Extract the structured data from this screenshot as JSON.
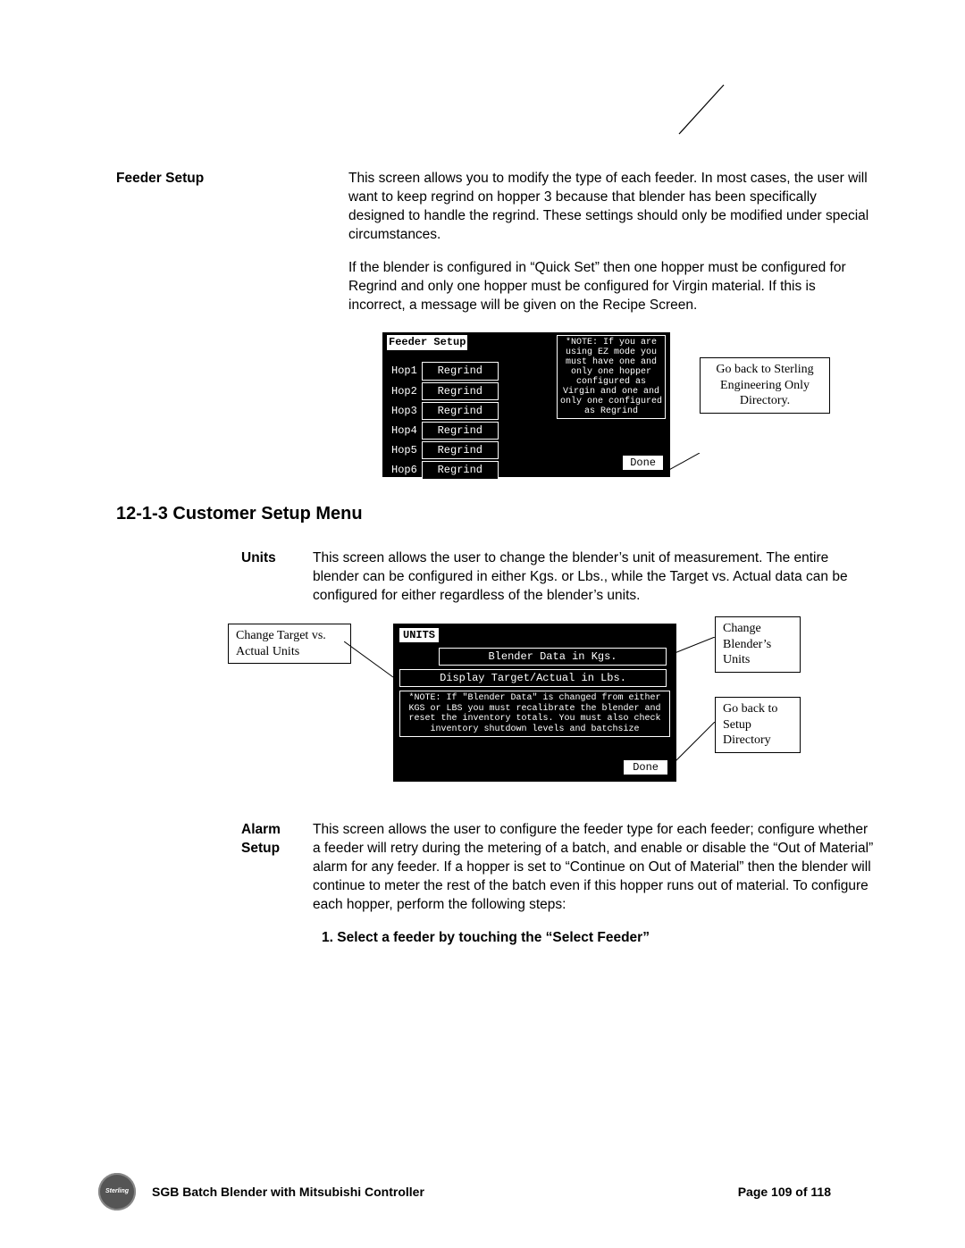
{
  "feeder_setup": {
    "heading": "Feeder Setup",
    "para1": "This screen allows you to modify the type of each feeder.  In most cases, the user will want to keep regrind on hopper 3 because that blender has been specifically designed to handle the regrind.  These settings should only be modified under special circumstances.",
    "para2": "If the blender is configured in “Quick Set” then one hopper must be configured for Regrind and only one hopper must be configured for Virgin material.  If this is incorrect, a message will be given on the Recipe Screen.",
    "hmi_title": "Feeder Setup",
    "hoppers": [
      {
        "name": "Hop1",
        "type": "Regrind"
      },
      {
        "name": "Hop2",
        "type": "Regrind"
      },
      {
        "name": "Hop3",
        "type": "Regrind"
      },
      {
        "name": "Hop4",
        "type": "Regrind"
      },
      {
        "name": "Hop5",
        "type": "Regrind"
      },
      {
        "name": "Hop6",
        "type": "Regrind"
      }
    ],
    "note": "*NOTE:  If you are using EZ mode you must have one and only one hopper configured as Virgin and one and only one configured as Regrind",
    "done": "Done",
    "callout": "Go back to Sterling Engineering Only Directory."
  },
  "section_heading": "12-1-3  Customer Setup Menu",
  "units": {
    "heading": "Units",
    "para": "This screen allows the user to change the blender’s unit of measurement.  The entire blender can be configured in either Kgs. or Lbs., while the Target vs. Actual data can be configured for either regardless of the blender’s units.",
    "hmi_title": "UNITS",
    "field1": "Blender Data in Kgs.",
    "field2": "Display Target/Actual in Lbs.",
    "note": "*NOTE:  If \"Blender Data\" is changed from either KGS or LBS you must recalibrate the blender and reset the inventory totals.  You must also check inventory shutdown levels and batchsize",
    "done": "Done",
    "callout_left": "Change Target vs. Actual Units",
    "callout_tr": "Change Blender’s Units",
    "callout_br": "Go back to Setup Directory"
  },
  "alarm": {
    "heading": "Alarm Setup",
    "h1": "Alarm",
    "h2": "Setup",
    "para": "This screen allows the user to configure the feeder type for each feeder; configure whether a feeder will retry during the metering of a batch, and enable or disable the “Out of Material” alarm for any feeder.  If a hopper is set to “Continue on Out of Material” then the blender will continue to meter the rest of the batch even if this hopper runs out of material. To configure each hopper, perform the following steps:",
    "step1": "1.   Select a feeder by touching the “Select Feeder”"
  },
  "footer": {
    "logo": "Sterling",
    "title": "SGB Batch Blender with Mitsubishi Controller",
    "page": "Page 109 of 118"
  }
}
